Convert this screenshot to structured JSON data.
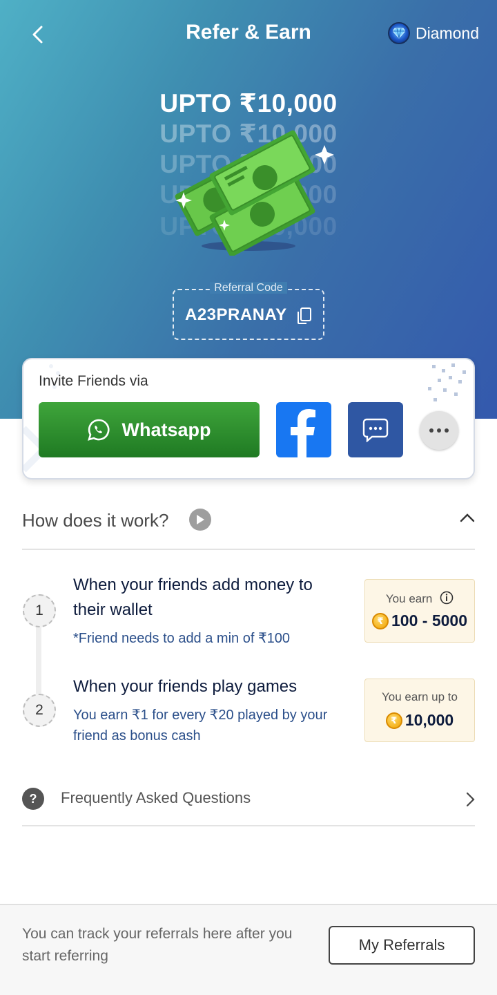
{
  "header": {
    "title": "Refer & Earn",
    "tier_label": "Diamond"
  },
  "hero": {
    "headline": "UPTO ₹10,000",
    "echo_text": "UPTO ₹10,000"
  },
  "referral": {
    "label": "Referral Code",
    "code": "A23PRANAY"
  },
  "invite": {
    "title": "Invite Friends via",
    "whatsapp_label": "Whatsapp"
  },
  "how": {
    "title": "How does it work?"
  },
  "steps": [
    {
      "number": "1",
      "heading": "When your friends add money to their wallet",
      "sub": "*Friend needs to add a min of ₹100",
      "earn_label": "You earn",
      "earn_value": "100 - 5000"
    },
    {
      "number": "2",
      "heading": "When your friends play games",
      "sub": "You earn ₹1 for every ₹20 played by your friend as bonus cash",
      "earn_label": "You earn up to",
      "earn_value": "10,000"
    }
  ],
  "faq": {
    "label": "Frequently Asked Questions"
  },
  "footer": {
    "text": "You can track your referrals here after you start referring",
    "button_label": "My Referrals"
  },
  "colors": {
    "whatsapp": "#2e8f2f",
    "facebook": "#1877f2",
    "sms": "#2f57a3",
    "earn_box_bg": "#fdf6e6"
  }
}
